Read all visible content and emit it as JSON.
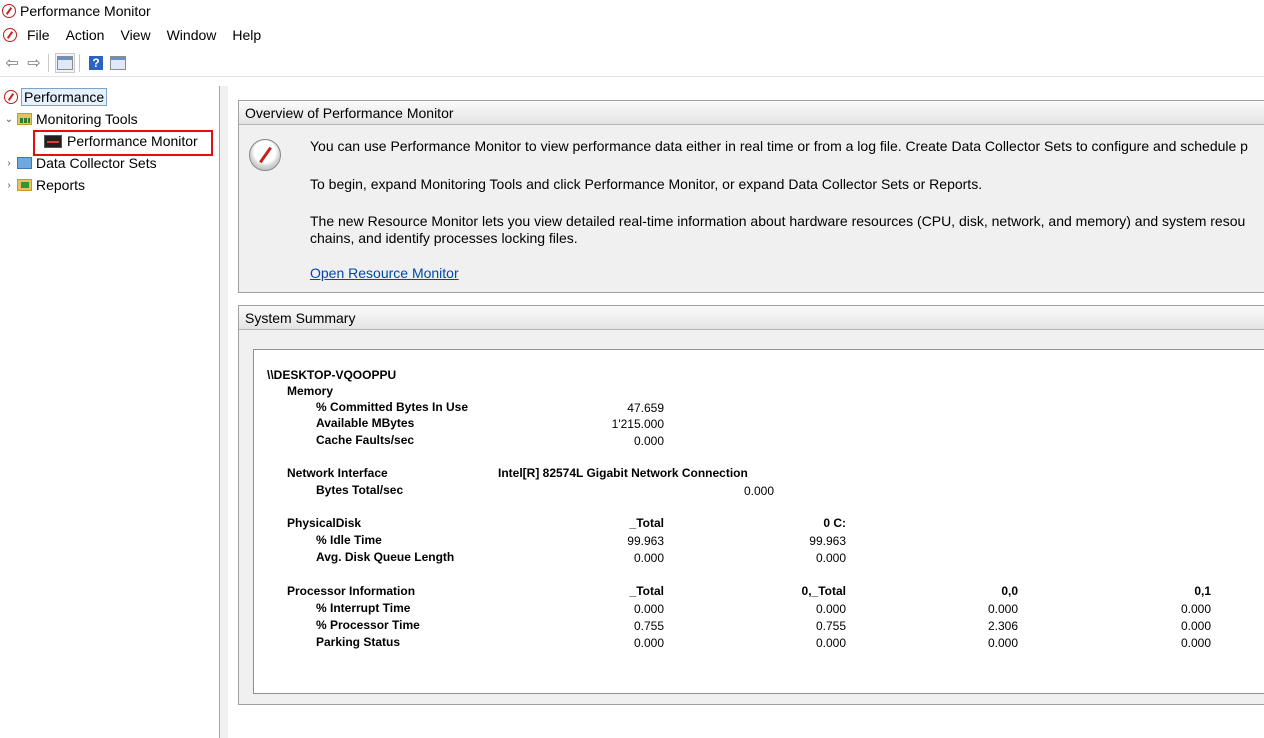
{
  "window": {
    "title": "Performance Monitor"
  },
  "menu": [
    "File",
    "Action",
    "View",
    "Window",
    "Help"
  ],
  "toolbar": {
    "back_icon": "back-arrow-icon",
    "forward_icon": "forward-arrow-icon",
    "show_hide_tree_icon": "console-tree-icon",
    "help_icon": "help-icon",
    "help_glyph": "?",
    "properties_icon": "properties-icon"
  },
  "tree": {
    "root": "Performance",
    "monitoring_tools": "Monitoring Tools",
    "performance_monitor": "Performance Monitor",
    "data_collector_sets": "Data Collector Sets",
    "reports": "Reports"
  },
  "overview": {
    "header": "Overview of Performance Monitor",
    "p1": "You can use Performance Monitor to view performance data either in real time or from a log file. Create Data Collector Sets to configure and schedule p",
    "p2": "To begin, expand Monitoring Tools and click Performance Monitor, or expand Data Collector Sets or Reports.",
    "p3a": "The new Resource Monitor lets you view detailed real-time information about hardware resources (CPU, disk, network, and memory) and system resou",
    "p3b": "chains, and identify processes locking files.",
    "link": "Open Resource Monitor"
  },
  "summary": {
    "header": "System Summary",
    "machine": "\\\\DESKTOP-VQOOPPU",
    "memory": {
      "label": "Memory",
      "rows": [
        {
          "name": "% Committed Bytes In Use",
          "value": "47.659"
        },
        {
          "name": "Available MBytes",
          "value": "1'215.000"
        },
        {
          "name": "Cache Faults/sec",
          "value": "0.000"
        }
      ]
    },
    "network": {
      "label": "Network Interface",
      "instance": "Intel[R] 82574L Gigabit Network Connection",
      "rows": [
        {
          "name": "Bytes Total/sec",
          "value": "0.000"
        }
      ]
    },
    "disk": {
      "label": "PhysicalDisk",
      "instances": [
        "_Total",
        "0 C:"
      ],
      "rows": [
        {
          "name": "% Idle Time",
          "values": [
            "99.963",
            "99.963"
          ]
        },
        {
          "name": "Avg. Disk Queue Length",
          "values": [
            "0.000",
            "0.000"
          ]
        }
      ]
    },
    "processor": {
      "label": "Processor Information",
      "instances": [
        "_Total",
        "0,_Total",
        "0,0",
        "0,1"
      ],
      "rows": [
        {
          "name": "% Interrupt Time",
          "values": [
            "0.000",
            "0.000",
            "0.000",
            "0.000"
          ]
        },
        {
          "name": "% Processor Time",
          "values": [
            "0.755",
            "0.755",
            "2.306",
            "0.000"
          ]
        },
        {
          "name": "Parking Status",
          "values": [
            "0.000",
            "0.000",
            "0.000",
            "0.000"
          ]
        }
      ]
    }
  }
}
